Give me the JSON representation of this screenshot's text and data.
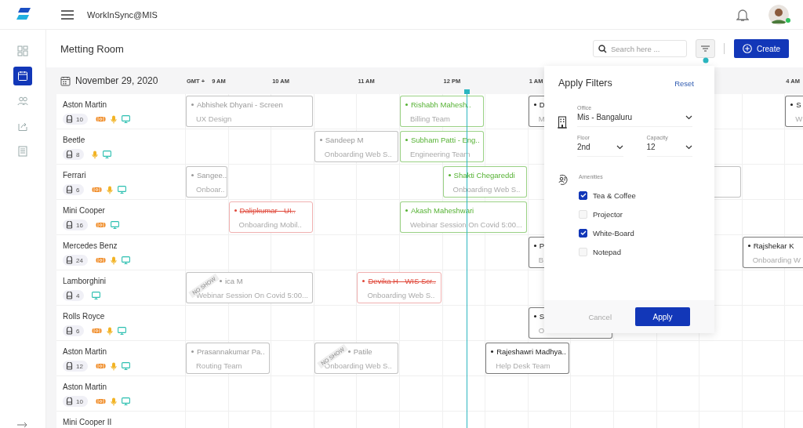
{
  "app": {
    "title": "WorkInSync@MIS"
  },
  "sidebar": {
    "items": [
      {
        "kind": "dashboard",
        "selected": false
      },
      {
        "kind": "calendar",
        "selected": true
      },
      {
        "kind": "people",
        "selected": false
      },
      {
        "kind": "share",
        "selected": false
      },
      {
        "kind": "document",
        "selected": false
      }
    ]
  },
  "page": {
    "title": "Metting Room"
  },
  "search": {
    "placeholder": "Search here ..."
  },
  "create_button": {
    "label": "Create"
  },
  "schedule": {
    "date": "November 29, 2020",
    "timezone": "GMT +",
    "hours": [
      {
        "label": "9 AM"
      },
      {
        "label": "10 AM"
      },
      {
        "label": "11 AM"
      },
      {
        "label": "12 PM"
      },
      {
        "label": "1 AM"
      },
      {
        "label": "4 AM"
      }
    ],
    "rooms": [
      {
        "name": "Aston Martin",
        "capacity": "10",
        "projector": true,
        "microphone": true,
        "display": true,
        "bookings": [
          {
            "color": "#999999",
            "cancelled": false,
            "title": "Abhishek Dhyani - Screen",
            "subtitle": "UX Design"
          },
          {
            "color": "#56b234",
            "cancelled": false,
            "title": "Rishabh Mahesh..",
            "subtitle": "Billing Team"
          },
          {
            "color": "#222222",
            "cancelled": false,
            "title": "D",
            "subtitle": "M"
          },
          {
            "color": "#222222",
            "cancelled": false,
            "title": "S",
            "subtitle": "W"
          }
        ]
      },
      {
        "name": "Beetle",
        "capacity": "8",
        "projector": false,
        "microphone": true,
        "display": true,
        "bookings": [
          {
            "color": "#999999",
            "cancelled": false,
            "title": "Sandeep M",
            "subtitle": "Onboarding Web S.."
          },
          {
            "color": "#56b234",
            "cancelled": false,
            "title": "Subham Patti - Eng..",
            "subtitle": "Engineering Team"
          }
        ]
      },
      {
        "name": "Ferrari",
        "capacity": "6",
        "projector": true,
        "microphone": true,
        "display": true,
        "bookings": [
          {
            "color": "#999999",
            "cancelled": false,
            "title": "Sangee..",
            "subtitle": "Onboar.."
          },
          {
            "color": "#56b234",
            "cancelled": false,
            "title": "Shakti Chegareddi",
            "subtitle": "Onboarding Web S.."
          },
          {
            "cancelled": false
          }
        ]
      },
      {
        "name": "Mini Cooper",
        "capacity": "16",
        "projector": true,
        "microphone": false,
        "display": true,
        "bookings": [
          {
            "color": "#e0493b",
            "cancelled": true,
            "title": "Dalipkumar - UI..",
            "subtitle": "Onboarding Mobil.."
          },
          {
            "color": "#56b234",
            "cancelled": false,
            "title": "Akash Maheshwari",
            "subtitle": "Webinar Session On Covid 5:00..."
          }
        ]
      },
      {
        "name": "Mercedes Benz",
        "capacity": "24",
        "projector": true,
        "microphone": true,
        "display": true,
        "bookings": [
          {
            "color": "#222222",
            "cancelled": false,
            "title": "P",
            "subtitle": "B"
          },
          {
            "color": "#222222",
            "cancelled": false,
            "title": "Rajshekar K",
            "subtitle": "Onboarding W"
          }
        ]
      },
      {
        "name": "Lamborghini",
        "capacity": "4",
        "projector": false,
        "microphone": false,
        "display": true,
        "bookings": [
          {
            "color": "#999999",
            "cancelled": false,
            "ribbon": "NO SHOW",
            "title": "ica M",
            "subtitle": "Webinar Session On Covid 5:00..."
          },
          {
            "color": "#e0493b",
            "cancelled": true,
            "title": "Devika H - WIS Scr..",
            "subtitle": "Onboarding Web S.."
          }
        ]
      },
      {
        "name": "Rolls Royce",
        "capacity": "6",
        "projector": true,
        "microphone": true,
        "display": true,
        "bookings": [
          {
            "color": "#222222",
            "cancelled": false,
            "title": "S",
            "subtitle": "O"
          }
        ]
      },
      {
        "name": "Aston Martin",
        "capacity": "12",
        "projector": true,
        "microphone": true,
        "display": true,
        "bookings": [
          {
            "color": "#999999",
            "cancelled": false,
            "title": "Prasannakumar Pa..",
            "subtitle": "Routing Team"
          },
          {
            "color": "#999999",
            "cancelled": false,
            "ribbon": "NO SHOW",
            "title": "Patile",
            "subtitle": "Onboarding Web S.."
          },
          {
            "color": "#222222",
            "cancelled": false,
            "title": "Rajeshawri Madhya..",
            "subtitle": "Help Desk Team"
          }
        ]
      },
      {
        "name": "Aston Martin",
        "capacity": "10",
        "projector": true,
        "microphone": true,
        "display": true
      },
      {
        "name": "Mini Cooper II"
      }
    ]
  },
  "filters": {
    "title": "Apply Filters",
    "reset": "Reset",
    "office": {
      "label": "Office",
      "value": "Mis - Bangaluru"
    },
    "floor": {
      "label": "Floor",
      "value": "2nd"
    },
    "capacity": {
      "label": "Capacity",
      "value": "12"
    },
    "amenities": {
      "label": "Amenities",
      "options": [
        {
          "label": "Tea & Coffee",
          "checked": true
        },
        {
          "label": "Projector",
          "checked": false
        },
        {
          "label": "White-Board",
          "checked": true
        },
        {
          "label": "Notepad",
          "checked": false
        }
      ]
    },
    "cancel": "Cancel",
    "apply": "Apply"
  }
}
